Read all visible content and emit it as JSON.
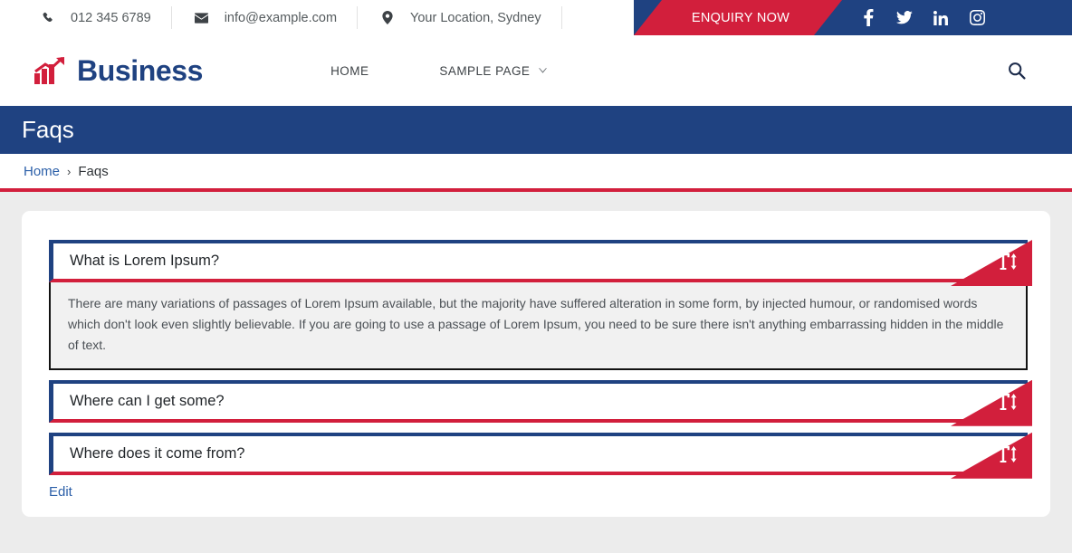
{
  "topbar": {
    "contacts": [
      {
        "icon": "phone-icon",
        "text": "012 345 6789"
      },
      {
        "icon": "envelope-icon",
        "text": "info@example.com"
      },
      {
        "icon": "map-pin-icon",
        "text": "Your Location, Sydney"
      }
    ],
    "enquiry_label": "ENQUIRY NOW",
    "socials": [
      "facebook-icon",
      "twitter-icon",
      "linkedin-icon",
      "instagram-icon"
    ],
    "colors": {
      "red": "#d21f3c",
      "navy": "#1f4281"
    }
  },
  "header": {
    "brand_text": "Business",
    "brand_icon": "growth-chart-icon",
    "nav": [
      {
        "label": "HOME",
        "has_caret": false
      },
      {
        "label": "SAMPLE PAGE",
        "has_caret": true
      }
    ],
    "search_icon": "search-icon"
  },
  "banner": {
    "title": "Faqs"
  },
  "breadcrumb": {
    "home": "Home",
    "separator": "›",
    "current": "Faqs"
  },
  "faqs": {
    "items": [
      {
        "question": "What is Lorem Ipsum?",
        "expanded": true,
        "answer": "There are many variations of passages of Lorem Ipsum available, but the majority have suffered alteration in some form, by injected humour, or randomised words which don't look even slightly believable. If you are going to use a passage of Lorem Ipsum, you need to be sure there isn't anything embarrassing hidden in the middle of text.",
        "toggle_icon": "text-height-icon"
      },
      {
        "question": "Where can I get some?",
        "expanded": false,
        "answer": "",
        "toggle_icon": "text-height-icon"
      },
      {
        "question": "Where does it come from?",
        "expanded": false,
        "answer": "",
        "toggle_icon": "text-height-icon"
      }
    ],
    "edit_label": "Edit"
  }
}
